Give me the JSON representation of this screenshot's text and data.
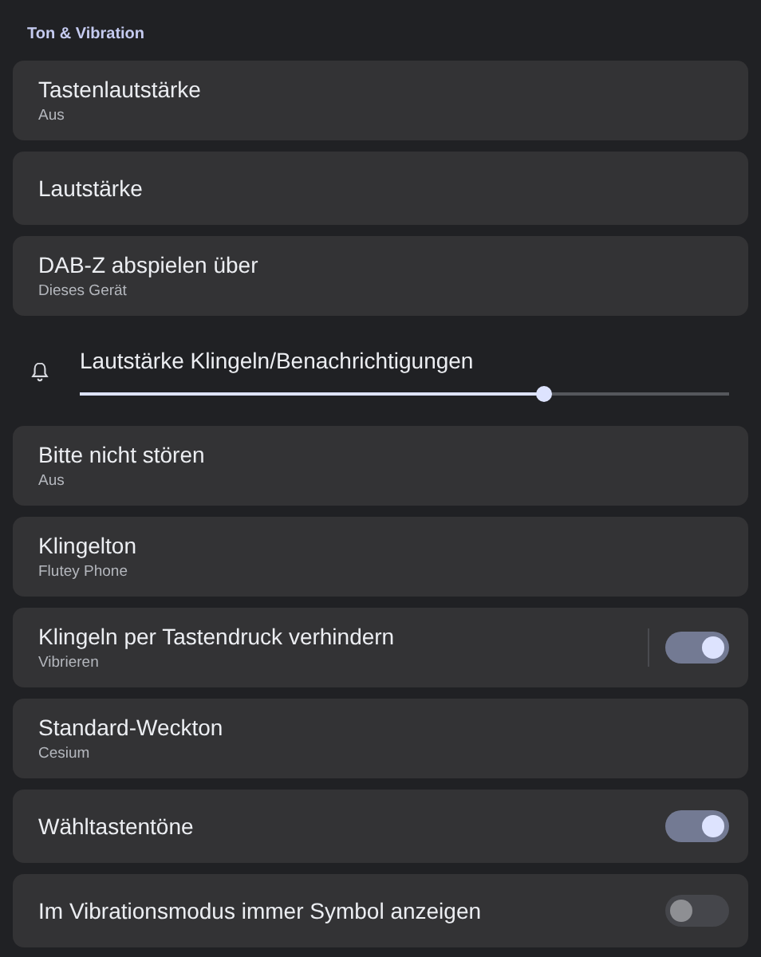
{
  "section_title": "Ton & Vibration",
  "items": [
    {
      "kind": "nav",
      "title": "Tastenlautstärke",
      "subtitle": "Aus"
    },
    {
      "kind": "nav",
      "title": "Lautstärke"
    },
    {
      "kind": "nav",
      "title": "DAB-Z abspielen über",
      "subtitle": "Dieses Gerät"
    },
    {
      "kind": "slider",
      "title": "Lautstärke Klingeln/Benachrichtigungen",
      "level": 0.715
    },
    {
      "kind": "nav",
      "title": "Bitte nicht stören",
      "subtitle": "Aus"
    },
    {
      "kind": "nav",
      "title": "Klingelton",
      "subtitle": "Flutey Phone"
    },
    {
      "kind": "toggle",
      "title": "Klingeln per Tastendruck verhindern",
      "subtitle": "Vibrieren",
      "on": true,
      "divider": true
    },
    {
      "kind": "nav",
      "title": "Standard-Weckton",
      "subtitle": "Cesium"
    },
    {
      "kind": "toggle",
      "title": "Wähltastentöne",
      "on": true,
      "divider": false
    },
    {
      "kind": "toggle",
      "title": "Im Vibrationsmodus immer Symbol anzeigen",
      "on": false,
      "divider": false
    }
  ]
}
